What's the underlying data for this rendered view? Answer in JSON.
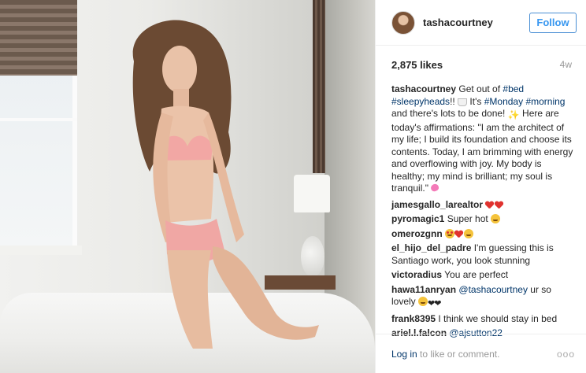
{
  "post": {
    "username": "tashacourtney",
    "follow_label": "Follow",
    "likes": "2,875 likes",
    "age": "4w"
  },
  "caption": {
    "user": "tashacourtney",
    "p1": " Get out of ",
    "tag_bed": "#bed",
    "tag_sleepyheads": "#sleepyheads",
    "p2": "!! ",
    "p3": " It's ",
    "tag_monday": "#Monday",
    "tag_morning": "#morning",
    "p4": " and there's lots to be done! ",
    "p5": " Here are today's affirmations: \"I am the architect of my life; I build its foundation and choose its contents. Today, I am brimming with energy and overflowing with joy. My body is healthy; my mind is brilliant; my soul is tranquil.\" "
  },
  "comments": [
    {
      "user": "jamesgallo_larealtor",
      "text": ""
    },
    {
      "user": "pyromagic1",
      "text": "Super hot"
    },
    {
      "user": "omerozgnn",
      "text": ""
    },
    {
      "user": "el_hijo_del_padre",
      "text": "I'm guessing this is Santiago work, you look stunning"
    },
    {
      "user": "victoradius",
      "text": "You are perfect"
    },
    {
      "user": "hawa11anryan",
      "mention": "@tashacourtney",
      "text": " ur so lovely"
    },
    {
      "user": "frank8395",
      "text": "I think we should stay in bed"
    },
    {
      "user": "ariel.l.falcon",
      "mention": "@ajsutton22"
    }
  ],
  "footer": {
    "login": "Log in",
    "rest": " to like or comment.",
    "more": "ooo"
  },
  "colors": {
    "link": "#003569",
    "follow": "#3897f0",
    "heart": "#e0322f"
  }
}
